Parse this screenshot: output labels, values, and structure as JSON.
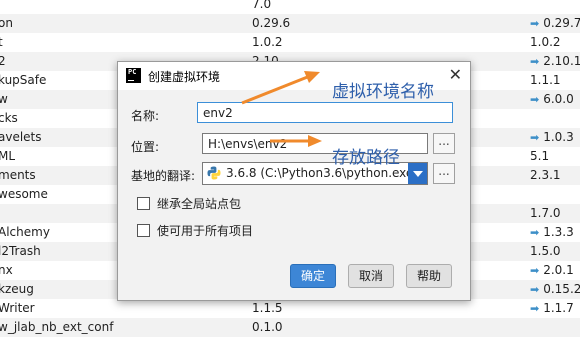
{
  "packages": [
    {
      "name": "",
      "version": "7.0",
      "latest": "",
      "upgrade": false
    },
    {
      "name": "on",
      "version": "0.29.6",
      "latest": "0.29.7",
      "upgrade": true
    },
    {
      "name": "t",
      "version": "1.0.2",
      "latest": "1.0.2",
      "upgrade": false
    },
    {
      "name": "2",
      "version": "2.10",
      "latest": "2.10.1",
      "upgrade": true
    },
    {
      "name": "kupSafe",
      "version": "",
      "latest": "1.1.1",
      "upgrade": false
    },
    {
      "name": "w",
      "version": "",
      "latest": "6.0.0",
      "upgrade": true
    },
    {
      "name": "cks",
      "version": "",
      "latest": "",
      "upgrade": false
    },
    {
      "name": "avelets",
      "version": "",
      "latest": "1.0.3",
      "upgrade": true
    },
    {
      "name": "ML",
      "version": "",
      "latest": "5.1",
      "upgrade": false
    },
    {
      "name": "ments",
      "version": "",
      "latest": "2.3.1",
      "upgrade": false
    },
    {
      "name": "wesome",
      "version": "",
      "latest": "",
      "upgrade": false
    },
    {
      "name": "",
      "version": "",
      "latest": "1.7.0",
      "upgrade": false
    },
    {
      "name": "Alchemy",
      "version": "",
      "latest": "1.3.3",
      "upgrade": true
    },
    {
      "name": "l2Trash",
      "version": "",
      "latest": "1.5.0",
      "upgrade": false
    },
    {
      "name": "nx",
      "version": "",
      "latest": "2.0.1",
      "upgrade": true
    },
    {
      "name": "kzeug",
      "version": "",
      "latest": "0.15.2",
      "upgrade": true
    },
    {
      "name": "Writer",
      "version": "1.1.5",
      "latest": "1.1.7",
      "upgrade": true
    },
    {
      "name": "w_jlab_nb_ext_conf",
      "version": "0.1.0",
      "latest": "",
      "upgrade": false
    }
  ],
  "dialog": {
    "title": "创建虚拟环境",
    "logo_text": "PC",
    "close_glyph": "✕",
    "name_label": "名称:",
    "name_value": "env2",
    "location_label": "位置:",
    "location_value": "H:\\envs\\env2",
    "browse_glyph": "...",
    "interpreter_label": "基地的翻译:",
    "interpreter_value": "3.6.8 (C:\\Python3.6\\python.exe)",
    "inherit_label": "继承全局站点包",
    "available_label": "使可用于所有项目",
    "ok_label": "确定",
    "cancel_label": "取消",
    "help_label": "帮助"
  },
  "annotations": {
    "env_name": "虚拟环境名称",
    "env_path": "存放路径"
  },
  "colors": {
    "accent": "#3d86d6",
    "annotation_text": "#2e5fab",
    "arrow": "#f08a2c",
    "upgrade_arrow": "#3d8fc8"
  },
  "icons": {
    "upgrade": "upgrade-arrow-icon",
    "python": "python-icon",
    "close": "close-icon"
  }
}
